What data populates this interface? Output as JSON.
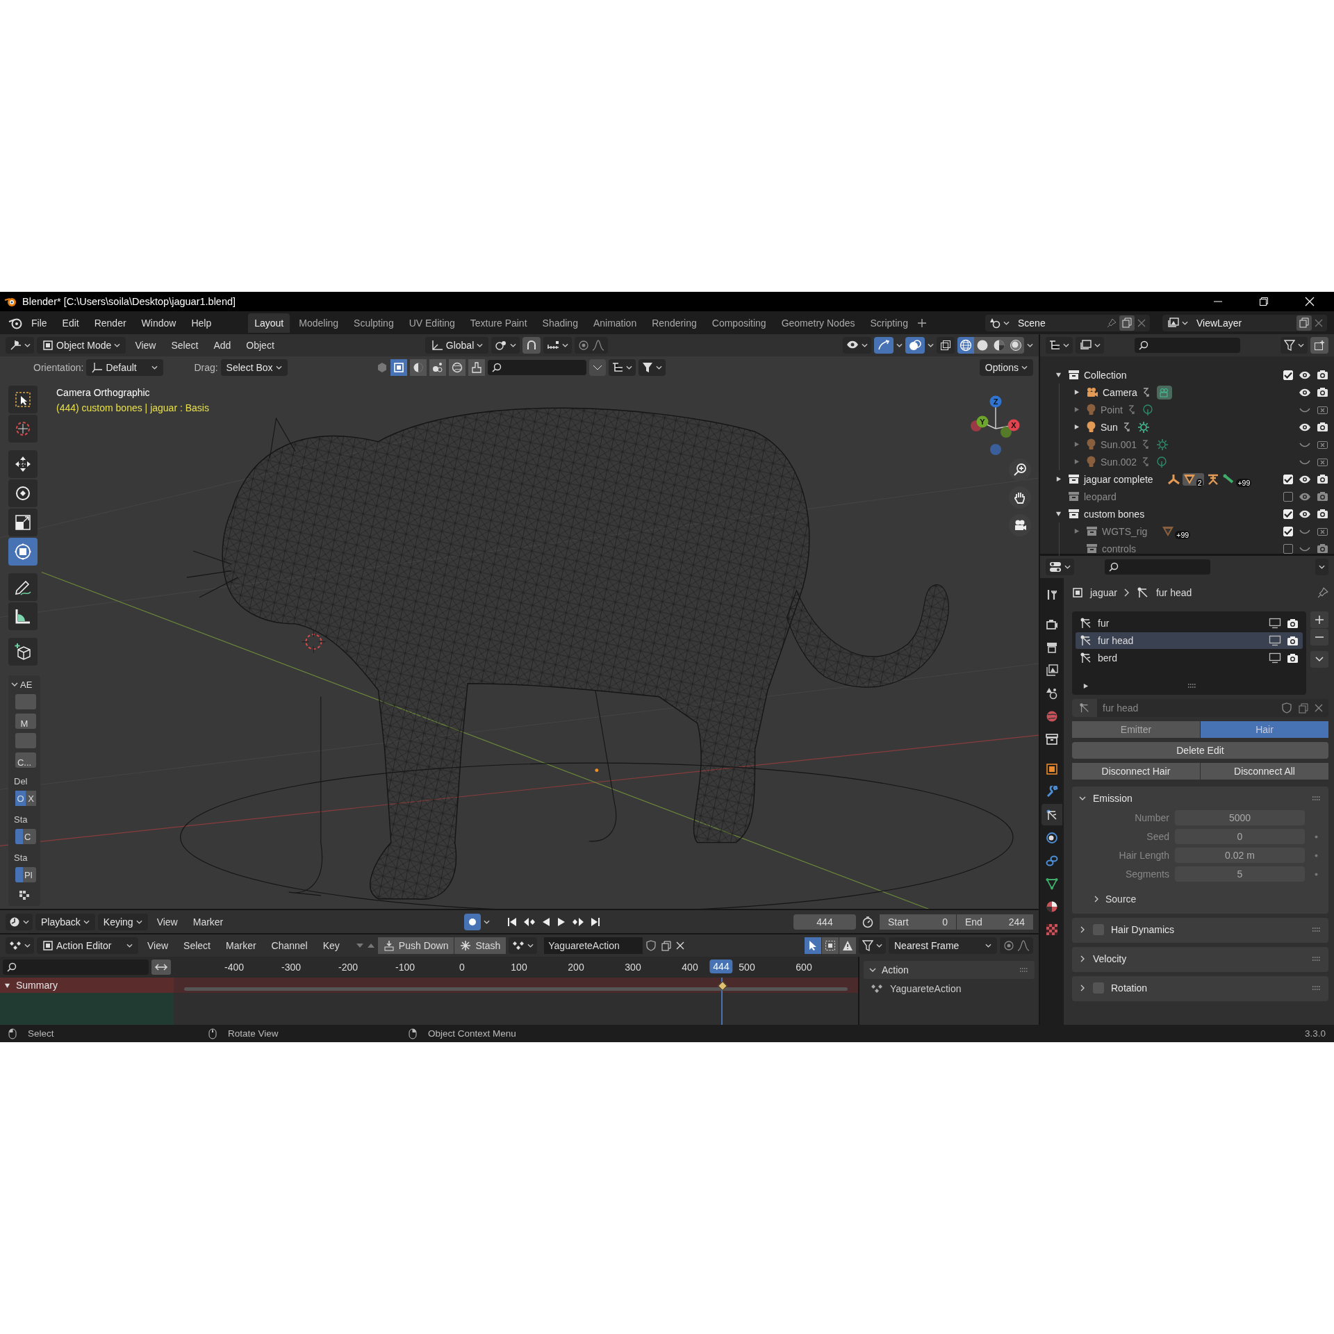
{
  "window": {
    "title": "Blender* [C:\\Users\\soila\\Desktop\\jaguar1.blend]"
  },
  "menu": [
    "File",
    "Edit",
    "Render",
    "Window",
    "Help"
  ],
  "workspaces": [
    {
      "label": "Layout",
      "selected": true
    },
    {
      "label": "Modeling",
      "selected": false
    },
    {
      "label": "Sculpting",
      "selected": false
    },
    {
      "label": "UV Editing",
      "selected": false
    },
    {
      "label": "Texture Paint",
      "selected": false
    },
    {
      "label": "Shading",
      "selected": false
    },
    {
      "label": "Animation",
      "selected": false
    },
    {
      "label": "Rendering",
      "selected": false
    },
    {
      "label": "Compositing",
      "selected": false
    },
    {
      "label": "Geometry Nodes",
      "selected": false
    },
    {
      "label": "Scripting",
      "selected": false
    }
  ],
  "scene": "Scene",
  "view_layer": "ViewLayer",
  "viewport": {
    "mode": "Object Mode",
    "menus": [
      "View",
      "Select",
      "Add",
      "Object"
    ],
    "orientation": "Global",
    "orientation_label": "Orientation:",
    "orientation_value": "Default",
    "drag_label": "Drag:",
    "drag_value": "Select Box",
    "options": "Options",
    "proportional": false,
    "camera_label": "Camera Orthographic",
    "info": "(444) custom bones | jaguar : Basis",
    "shading": [
      {
        "kind": "wireframe",
        "selected": true
      },
      {
        "kind": "solid",
        "selected": false
      },
      {
        "kind": "material",
        "selected": false
      },
      {
        "kind": "rendered",
        "selected": false
      }
    ],
    "axes": [
      {
        "label": "Z",
        "color": "#2f74d0"
      },
      {
        "label": "Y",
        "color": "#6ea62b"
      },
      {
        "label": "X",
        "color": "#e0444f"
      }
    ],
    "tools": [
      {
        "kind": "select_box",
        "selected": false
      },
      {
        "kind": "cursor",
        "selected": false
      },
      {
        "kind": "move",
        "selected": false
      },
      {
        "kind": "rotate",
        "selected": false
      },
      {
        "kind": "scale",
        "selected": false
      },
      {
        "kind": "transform",
        "selected": true
      },
      {
        "kind": "annotate",
        "selected": false
      },
      {
        "kind": "measure",
        "selected": false
      },
      {
        "kind": "add_cube",
        "selected": false
      }
    ],
    "side_panel": {
      "title": "AE",
      "rows": [
        {
          "kind": "blank"
        },
        {
          "kind": "button",
          "label": "M"
        },
        {
          "kind": "blank"
        },
        {
          "kind": "button",
          "label": "C..."
        },
        {
          "kind": "label",
          "label": "Del"
        },
        {
          "kind": "toggle",
          "options": [
            {
              "label": "O",
              "selected": true
            },
            {
              "label": "X",
              "selected": false
            }
          ]
        },
        {
          "kind": "label",
          "label": "Sta"
        },
        {
          "kind": "switch",
          "label": "C",
          "on": true
        },
        {
          "kind": "label",
          "label": "Sta"
        },
        {
          "kind": "switch",
          "label": "Pl",
          "on": true
        }
      ]
    }
  },
  "outliner": {
    "items": [
      {
        "name": "Collection",
        "kind": "collection",
        "expanded": true,
        "checked": true,
        "visible": true,
        "renderable": true,
        "disabled": false,
        "children": [
          {
            "name": "Camera",
            "kind": "camera",
            "data": {
              "kind": "camera"
            },
            "expanded": false,
            "visible": true,
            "renderable": true,
            "disabled": false
          },
          {
            "name": "Point",
            "kind": "light",
            "data": {
              "kind": "point"
            },
            "expanded": false,
            "visible": false,
            "renderable": false,
            "disabled": true
          },
          {
            "name": "Sun",
            "kind": "light",
            "data": {
              "kind": "sun"
            },
            "expanded": false,
            "visible": true,
            "renderable": true,
            "disabled": false
          },
          {
            "name": "Sun.001",
            "kind": "light",
            "data": {
              "kind": "sun"
            },
            "expanded": false,
            "visible": false,
            "renderable": false,
            "disabled": true
          },
          {
            "name": "Sun.002",
            "kind": "light",
            "data": {
              "kind": "point"
            },
            "expanded": false,
            "visible": false,
            "renderable": false,
            "disabled": true
          }
        ]
      },
      {
        "name": "jaguar complete",
        "kind": "collection",
        "expanded": false,
        "checked": true,
        "visible": true,
        "renderable": true,
        "disabled": false,
        "contents": [
          {
            "kind": "armature"
          },
          {
            "kind": "mesh",
            "count": "2"
          },
          {
            "kind": "pose"
          },
          {
            "kind": "bone",
            "count": "+99"
          }
        ]
      },
      {
        "name": "leopard",
        "kind": "collection",
        "checked": false,
        "visible": true,
        "renderable": true,
        "disabled": true
      },
      {
        "name": "custom bones",
        "kind": "collection",
        "expanded": true,
        "checked": true,
        "visible": true,
        "renderable": true,
        "disabled": false,
        "children": [
          {
            "name": "WGTS_rig",
            "kind": "collection",
            "expanded": false,
            "checked": true,
            "visible": false,
            "renderable": false,
            "disabled": true,
            "contents": [
              {
                "kind": "mesh",
                "count": "+99"
              }
            ]
          },
          {
            "name": "controls",
            "kind": "collection",
            "checked": false,
            "visible": false,
            "renderable": true,
            "disabled": true
          }
        ]
      }
    ]
  },
  "properties": {
    "tabs": [
      {
        "kind": "tool",
        "selected": false
      },
      {
        "kind": "render",
        "selected": false
      },
      {
        "kind": "output",
        "selected": false
      },
      {
        "kind": "view_layer",
        "selected": false
      },
      {
        "kind": "scene",
        "selected": false
      },
      {
        "kind": "world",
        "selected": false
      },
      {
        "kind": "collection",
        "selected": false
      },
      {
        "kind": "object",
        "selected": false
      },
      {
        "kind": "modifiers",
        "selected": false
      },
      {
        "kind": "particles",
        "selected": true
      },
      {
        "kind": "physics",
        "selected": false
      },
      {
        "kind": "constraints",
        "selected": false
      },
      {
        "kind": "data",
        "selected": false
      },
      {
        "kind": "material",
        "selected": false
      },
      {
        "kind": "texture",
        "selected": false
      }
    ],
    "breadcrumb": [
      "jaguar",
      "fur head"
    ],
    "systems": [
      {
        "name": "fur",
        "selected": false
      },
      {
        "name": "fur head",
        "selected": true
      },
      {
        "name": "berd",
        "selected": false
      }
    ],
    "datablock": "fur head",
    "type_tabs": [
      {
        "label": "Emitter",
        "selected": false
      },
      {
        "label": "Hair",
        "selected": true
      }
    ],
    "delete_edit": "Delete Edit",
    "disconnect": [
      "Disconnect Hair",
      "Disconnect All"
    ],
    "emission": {
      "title": "Emission",
      "expanded": true,
      "fields": [
        {
          "label": "Number",
          "value": "5000"
        },
        {
          "label": "Seed",
          "value": "0"
        },
        {
          "label": "Hair Length",
          "value": "0.02 m"
        },
        {
          "label": "Segments",
          "value": "5"
        }
      ],
      "subpanel": "Source"
    },
    "panels": [
      {
        "title": "Hair Dynamics",
        "checked": false
      },
      {
        "title": "Velocity"
      },
      {
        "title": "Rotation",
        "checked": false
      }
    ]
  },
  "timeline": {
    "menus": [
      "Playback",
      "Keying",
      "View",
      "Marker"
    ],
    "current_frame": "444",
    "start_label": "Start",
    "start": "0",
    "end_label": "End",
    "end": "244"
  },
  "action_editor": {
    "mode": "Action Editor",
    "menus": [
      "View",
      "Select",
      "Marker",
      "Channel",
      "Key"
    ],
    "push_down": "Push Down",
    "stash": "Stash",
    "action": "YaguareteAction",
    "snapping": "Nearest Frame",
    "proportional": false,
    "ticks": [
      "-400",
      "-300",
      "-200",
      "-100",
      "0",
      "100",
      "200",
      "300",
      "400",
      "500",
      "600"
    ],
    "playhead": {
      "label": "444",
      "level": 0.8
    },
    "channels": [
      "Summary"
    ],
    "sidebar_panel": "Action",
    "sidebar_action": "YaguareteAction"
  },
  "status_bar": {
    "hints": [
      "Select",
      "Rotate View",
      "Object Context Menu"
    ],
    "version": "3.3.0"
  }
}
